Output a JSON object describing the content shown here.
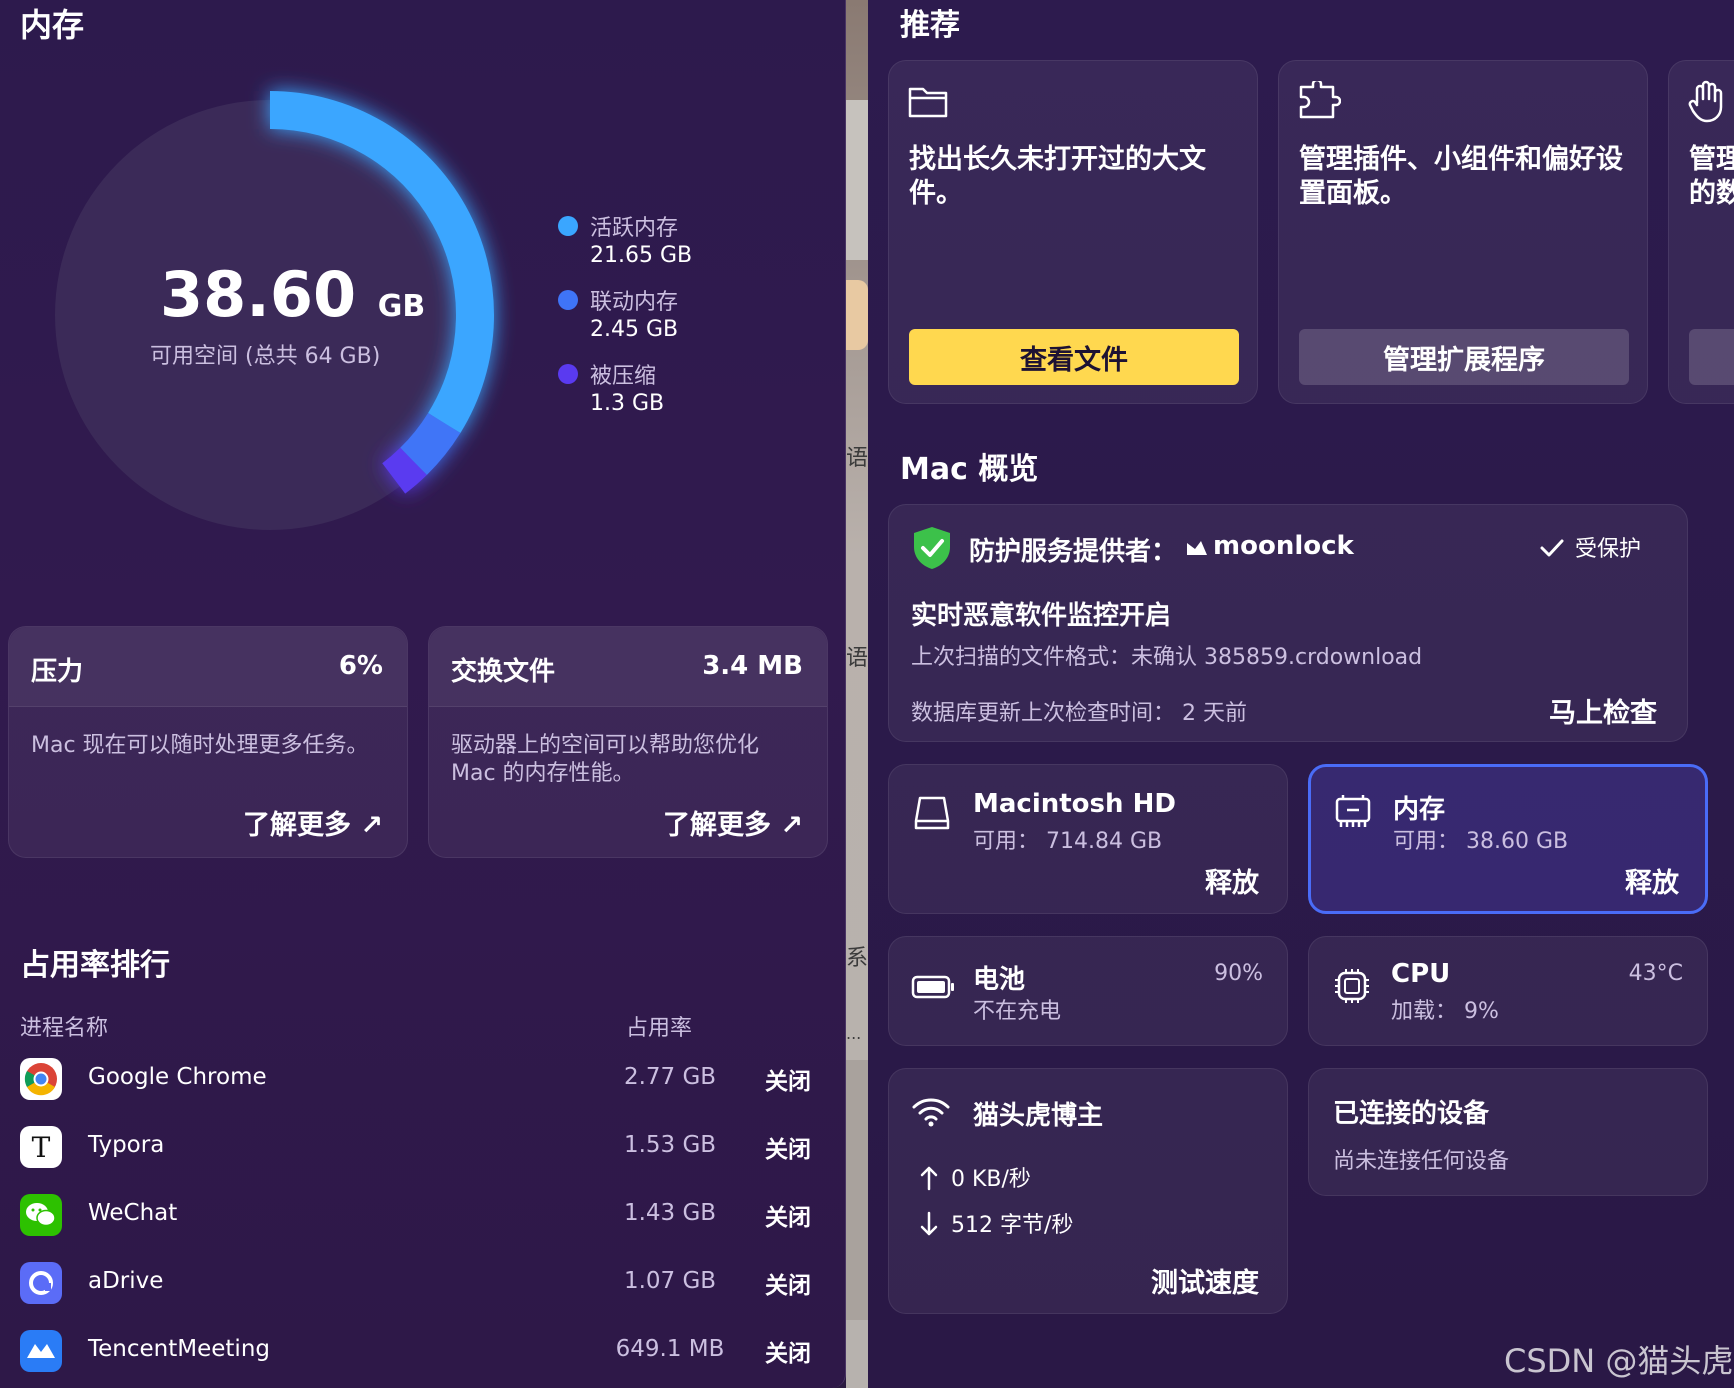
{
  "memory": {
    "title": "内存",
    "available_value": "38.60",
    "available_unit": "GB",
    "available_label": "可用空间 (总共 64 GB)",
    "segments": [
      {
        "label": "活跃内存",
        "value": "21.65 GB",
        "gb": 21.65,
        "color": "#3aa6ff"
      },
      {
        "label": "联动内存",
        "value": "2.45 GB",
        "gb": 2.45,
        "color": "#3f74f7"
      },
      {
        "label": "被压缩",
        "value": "1.3 GB",
        "gb": 1.3,
        "color": "#5a3af0"
      }
    ],
    "total_gb": 64
  },
  "pressure": {
    "title": "压力",
    "value": "6%",
    "desc": "Mac 现在可以随时处理更多任务。",
    "link": "了解更多 ↗"
  },
  "swap": {
    "title": "交换文件",
    "value": "3.4 MB",
    "desc_line1": "驱动器上的空间可以帮助您优化",
    "desc_line2": "Mac 的内存性能。",
    "link": "了解更多 ↗"
  },
  "ranking": {
    "title": "占用率排行",
    "col_name": "进程名称",
    "col_usage": "占用率",
    "rows": [
      {
        "name": "Google Chrome",
        "usage": "2.77 GB",
        "action": "关闭"
      },
      {
        "name": "Typora",
        "usage": "1.53 GB",
        "action": "关闭"
      },
      {
        "name": "WeChat",
        "usage": "1.43 GB",
        "action": "关闭"
      },
      {
        "name": "aDrive",
        "usage": "1.07 GB",
        "action": "关闭"
      },
      {
        "name": "TencentMeeting",
        "usage": "649.1 MB",
        "action": "关闭"
      }
    ]
  },
  "gap": {
    "s1": "语?",
    "s2": "语头",
    "s3": "系",
    "s4": "..."
  },
  "recommend": {
    "title": "推荐",
    "cards": [
      {
        "text_line1": "找出长久未打开过的大文",
        "text_line2": "件。",
        "button": "查看文件",
        "icon": "folder-icon"
      },
      {
        "text_line1": "管理插件、小组件和偏好设",
        "text_line2": "置面板。",
        "button": "管理扩展程序",
        "icon": "puzzle-icon"
      },
      {
        "text_line1": "管理",
        "text_line2": "的数",
        "button": "",
        "icon": "hand-icon"
      }
    ]
  },
  "overview": {
    "title": "Mac 概览",
    "protection": {
      "provider_label": "防护服务提供者：",
      "provider_name": "moonlock",
      "status": "受保护",
      "monitor": "实时恶意软件监控开启",
      "last_scan": "上次扫描的文件格式：未确认 385859.crdownload",
      "db_update": "数据库更新上次检查时间：  2 天前",
      "check_now": "马上检查"
    },
    "disk": {
      "title": "Macintosh HD",
      "sub": "可用：  714.84 GB",
      "action": "释放"
    },
    "mem": {
      "title": "内存",
      "sub": "可用：  38.60 GB",
      "action": "释放"
    },
    "battery": {
      "title": "电池",
      "sub": "不在充电",
      "value": "90%"
    },
    "cpu": {
      "title": "CPU",
      "sub": "加载：  9%",
      "value": "43°C"
    },
    "network": {
      "title": "猫头虎博主",
      "up": "0 KB/秒",
      "down": "512 字节/秒",
      "action": "测试速度"
    },
    "devices": {
      "title": "已连接的设备",
      "sub": "尚未连接任何设备"
    }
  },
  "watermark": "CSDN @猫头虎"
}
